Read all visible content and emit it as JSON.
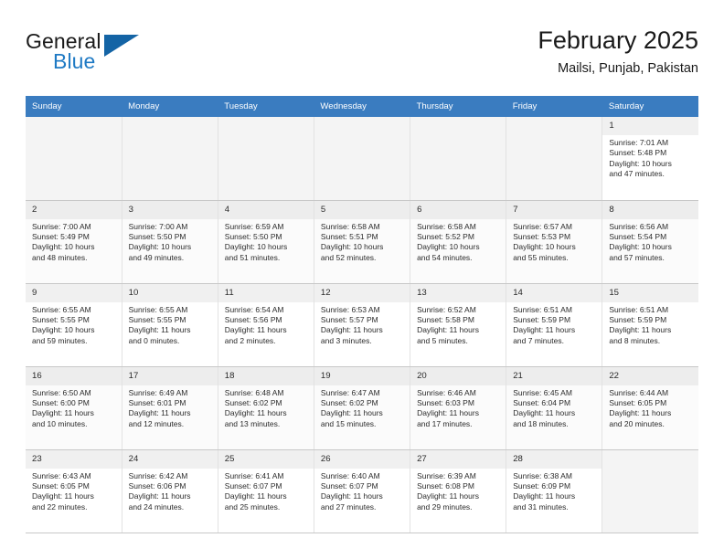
{
  "brand": {
    "word1": "General",
    "word2": "Blue",
    "triangle_color": "#1464a5",
    "blue_color": "#1f7ac4"
  },
  "header": {
    "month_title": "February 2025",
    "location": "Mailsi, Punjab, Pakistan",
    "header_bg": "#3a7cc0"
  },
  "calendar": {
    "weekday_headers": [
      "Sunday",
      "Monday",
      "Tuesday",
      "Wednesday",
      "Thursday",
      "Friday",
      "Saturday"
    ],
    "weeks": [
      [
        {
          "empty": true
        },
        {
          "empty": true
        },
        {
          "empty": true
        },
        {
          "empty": true
        },
        {
          "empty": true
        },
        {
          "empty": true
        },
        {
          "day": "1",
          "sunrise": "Sunrise: 7:01 AM",
          "sunset": "Sunset: 5:48 PM",
          "daylight1": "Daylight: 10 hours",
          "daylight2": "and 47 minutes."
        }
      ],
      [
        {
          "day": "2",
          "sunrise": "Sunrise: 7:00 AM",
          "sunset": "Sunset: 5:49 PM",
          "daylight1": "Daylight: 10 hours",
          "daylight2": "and 48 minutes."
        },
        {
          "day": "3",
          "sunrise": "Sunrise: 7:00 AM",
          "sunset": "Sunset: 5:50 PM",
          "daylight1": "Daylight: 10 hours",
          "daylight2": "and 49 minutes."
        },
        {
          "day": "4",
          "sunrise": "Sunrise: 6:59 AM",
          "sunset": "Sunset: 5:50 PM",
          "daylight1": "Daylight: 10 hours",
          "daylight2": "and 51 minutes."
        },
        {
          "day": "5",
          "sunrise": "Sunrise: 6:58 AM",
          "sunset": "Sunset: 5:51 PM",
          "daylight1": "Daylight: 10 hours",
          "daylight2": "and 52 minutes."
        },
        {
          "day": "6",
          "sunrise": "Sunrise: 6:58 AM",
          "sunset": "Sunset: 5:52 PM",
          "daylight1": "Daylight: 10 hours",
          "daylight2": "and 54 minutes."
        },
        {
          "day": "7",
          "sunrise": "Sunrise: 6:57 AM",
          "sunset": "Sunset: 5:53 PM",
          "daylight1": "Daylight: 10 hours",
          "daylight2": "and 55 minutes."
        },
        {
          "day": "8",
          "sunrise": "Sunrise: 6:56 AM",
          "sunset": "Sunset: 5:54 PM",
          "daylight1": "Daylight: 10 hours",
          "daylight2": "and 57 minutes."
        }
      ],
      [
        {
          "day": "9",
          "sunrise": "Sunrise: 6:55 AM",
          "sunset": "Sunset: 5:55 PM",
          "daylight1": "Daylight: 10 hours",
          "daylight2": "and 59 minutes."
        },
        {
          "day": "10",
          "sunrise": "Sunrise: 6:55 AM",
          "sunset": "Sunset: 5:55 PM",
          "daylight1": "Daylight: 11 hours",
          "daylight2": "and 0 minutes."
        },
        {
          "day": "11",
          "sunrise": "Sunrise: 6:54 AM",
          "sunset": "Sunset: 5:56 PM",
          "daylight1": "Daylight: 11 hours",
          "daylight2": "and 2 minutes."
        },
        {
          "day": "12",
          "sunrise": "Sunrise: 6:53 AM",
          "sunset": "Sunset: 5:57 PM",
          "daylight1": "Daylight: 11 hours",
          "daylight2": "and 3 minutes."
        },
        {
          "day": "13",
          "sunrise": "Sunrise: 6:52 AM",
          "sunset": "Sunset: 5:58 PM",
          "daylight1": "Daylight: 11 hours",
          "daylight2": "and 5 minutes."
        },
        {
          "day": "14",
          "sunrise": "Sunrise: 6:51 AM",
          "sunset": "Sunset: 5:59 PM",
          "daylight1": "Daylight: 11 hours",
          "daylight2": "and 7 minutes."
        },
        {
          "day": "15",
          "sunrise": "Sunrise: 6:51 AM",
          "sunset": "Sunset: 5:59 PM",
          "daylight1": "Daylight: 11 hours",
          "daylight2": "and 8 minutes."
        }
      ],
      [
        {
          "day": "16",
          "sunrise": "Sunrise: 6:50 AM",
          "sunset": "Sunset: 6:00 PM",
          "daylight1": "Daylight: 11 hours",
          "daylight2": "and 10 minutes."
        },
        {
          "day": "17",
          "sunrise": "Sunrise: 6:49 AM",
          "sunset": "Sunset: 6:01 PM",
          "daylight1": "Daylight: 11 hours",
          "daylight2": "and 12 minutes."
        },
        {
          "day": "18",
          "sunrise": "Sunrise: 6:48 AM",
          "sunset": "Sunset: 6:02 PM",
          "daylight1": "Daylight: 11 hours",
          "daylight2": "and 13 minutes."
        },
        {
          "day": "19",
          "sunrise": "Sunrise: 6:47 AM",
          "sunset": "Sunset: 6:02 PM",
          "daylight1": "Daylight: 11 hours",
          "daylight2": "and 15 minutes."
        },
        {
          "day": "20",
          "sunrise": "Sunrise: 6:46 AM",
          "sunset": "Sunset: 6:03 PM",
          "daylight1": "Daylight: 11 hours",
          "daylight2": "and 17 minutes."
        },
        {
          "day": "21",
          "sunrise": "Sunrise: 6:45 AM",
          "sunset": "Sunset: 6:04 PM",
          "daylight1": "Daylight: 11 hours",
          "daylight2": "and 18 minutes."
        },
        {
          "day": "22",
          "sunrise": "Sunrise: 6:44 AM",
          "sunset": "Sunset: 6:05 PM",
          "daylight1": "Daylight: 11 hours",
          "daylight2": "and 20 minutes."
        }
      ],
      [
        {
          "day": "23",
          "sunrise": "Sunrise: 6:43 AM",
          "sunset": "Sunset: 6:05 PM",
          "daylight1": "Daylight: 11 hours",
          "daylight2": "and 22 minutes."
        },
        {
          "day": "24",
          "sunrise": "Sunrise: 6:42 AM",
          "sunset": "Sunset: 6:06 PM",
          "daylight1": "Daylight: 11 hours",
          "daylight2": "and 24 minutes."
        },
        {
          "day": "25",
          "sunrise": "Sunrise: 6:41 AM",
          "sunset": "Sunset: 6:07 PM",
          "daylight1": "Daylight: 11 hours",
          "daylight2": "and 25 minutes."
        },
        {
          "day": "26",
          "sunrise": "Sunrise: 6:40 AM",
          "sunset": "Sunset: 6:07 PM",
          "daylight1": "Daylight: 11 hours",
          "daylight2": "and 27 minutes."
        },
        {
          "day": "27",
          "sunrise": "Sunrise: 6:39 AM",
          "sunset": "Sunset: 6:08 PM",
          "daylight1": "Daylight: 11 hours",
          "daylight2": "and 29 minutes."
        },
        {
          "day": "28",
          "sunrise": "Sunrise: 6:38 AM",
          "sunset": "Sunset: 6:09 PM",
          "daylight1": "Daylight: 11 hours",
          "daylight2": "and 31 minutes."
        },
        {
          "empty": true
        }
      ]
    ]
  }
}
